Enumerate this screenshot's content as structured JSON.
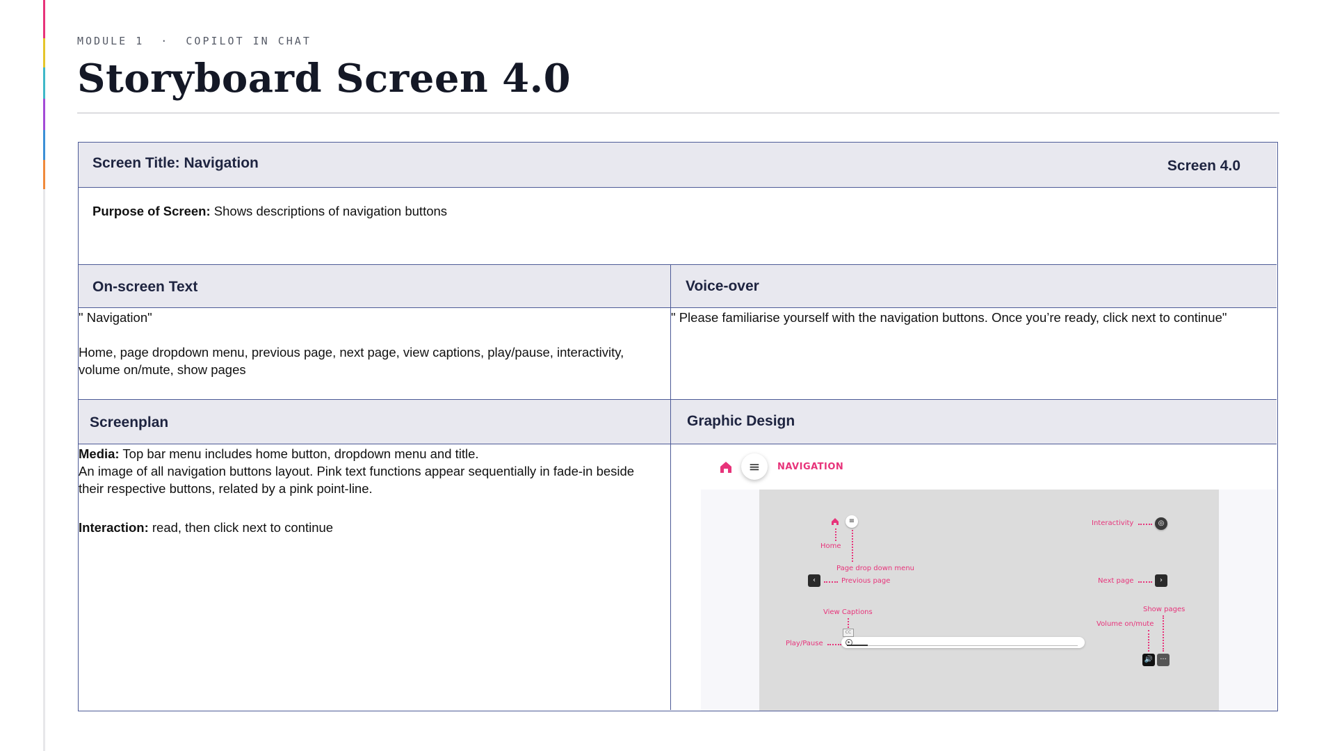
{
  "header": {
    "eyebrow": "MODULE 1  ·  COPILOT IN CHAT",
    "title": "Storyboard Screen 4.0"
  },
  "rail_colors": [
    "#e7337a",
    "#e5c52b",
    "#3fb8c8",
    "#a34bd6",
    "#3c8fd6",
    "#f08a3c"
  ],
  "storyboard": {
    "screen_title": "Screen Title: Navigation",
    "screen_number": "Screen 4.0",
    "purpose_label": "Purpose of Screen:",
    "purpose_text": " Shows descriptions of navigation buttons",
    "onscreen_header": "On-screen Text",
    "voiceover_header": "Voice-over",
    "onscreen_line1": "\" Navigation\"",
    "onscreen_line2": "Home, page dropdown menu, previous page, next page, view captions, play/pause, interactivity, volume on/mute, show pages",
    "voiceover_text": "\" Please familiarise yourself with the navigation buttons. Once you’re ready, click next to continue\"",
    "screenplan_header": "Screenplan",
    "graphic_header": "Graphic Design",
    "media_label": "Media:",
    "media_text": " Top bar menu includes home button, dropdown menu and title.",
    "media_text2": "An image of all navigation buttons layout. Pink text functions appear sequentially in fade-in beside their respective buttons, related by a pink point-line.",
    "interaction_label": "Interaction:",
    "interaction_text": " read, then click next to continue"
  },
  "graphic": {
    "title": "NAVIGATION",
    "labels": {
      "home": "Home",
      "page_menu": "Page drop down menu",
      "previous": "Previous page",
      "interactivity": "Interactivity",
      "next": "Next page",
      "captions": "View Captions",
      "show_pages": "Show pages",
      "volume": "Volume on/mute",
      "play_pause": "Play/Pause",
      "cc": "CC"
    },
    "accent": "#e7337a",
    "icons": [
      "home-icon",
      "menu-icon",
      "chevron-left-icon",
      "chevron-right-icon",
      "interactivity-icon",
      "volume-icon",
      "more-icon",
      "captions-icon",
      "play-icon"
    ]
  }
}
